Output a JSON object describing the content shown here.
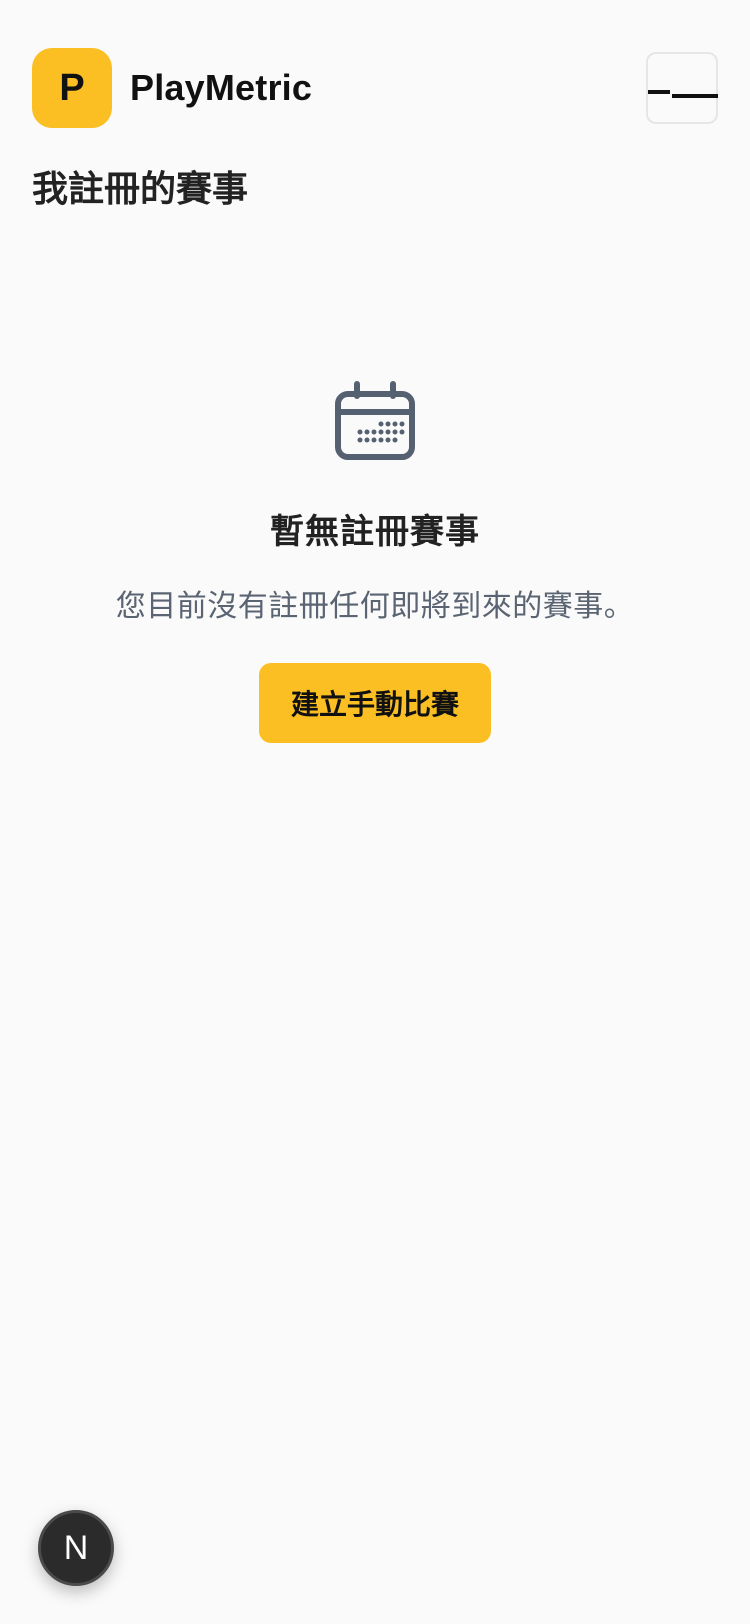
{
  "header": {
    "logo_letter": "P",
    "brand_name": "PlayMetric",
    "menu_icon": "hamburger-icon"
  },
  "page": {
    "title": "我註冊的賽事"
  },
  "empty_state": {
    "icon": "calendar-icon",
    "title": "暫無註冊賽事",
    "description": "您目前沒有註冊任何即將到來的賽事。",
    "cta_label": "建立手動比賽"
  },
  "floating_button": {
    "label": "N"
  },
  "colors": {
    "accent": "#fbbf24",
    "background": "#fafafa",
    "muted_text": "#5b6472",
    "icon": "#556070"
  }
}
